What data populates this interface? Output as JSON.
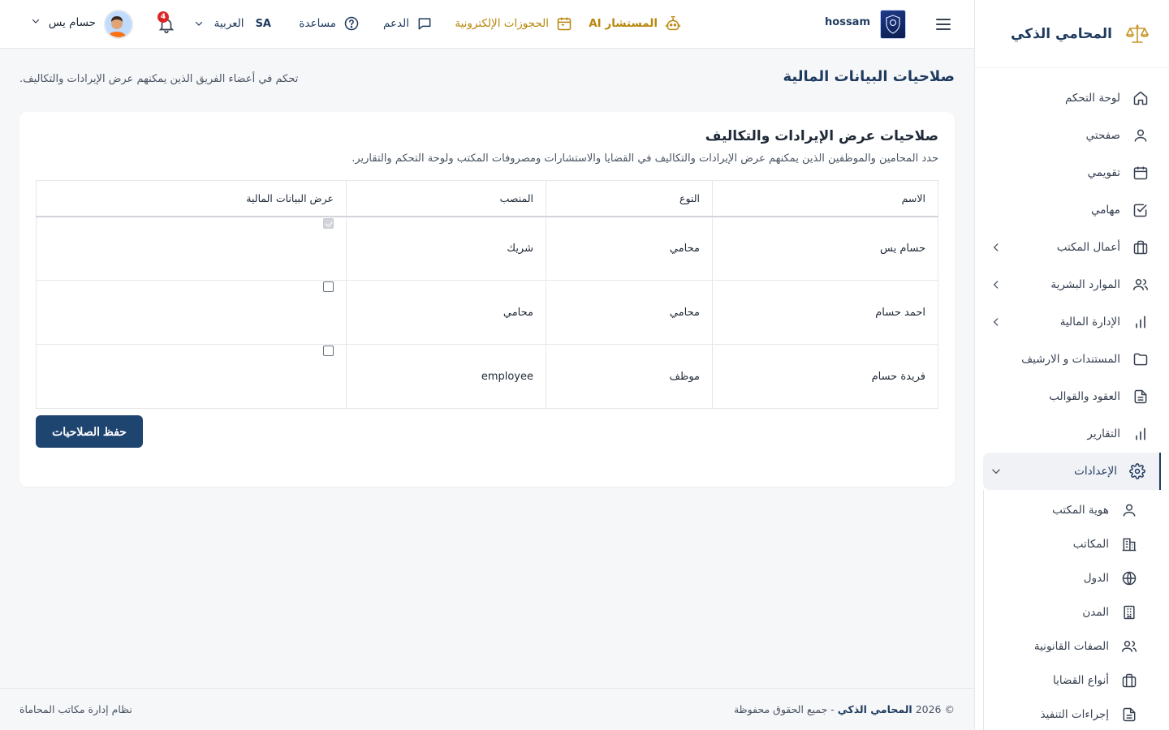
{
  "brand": {
    "name": "المحامي الذكي"
  },
  "sidebar": {
    "items": [
      {
        "label": "لوحة التحكم",
        "icon": "home-icon"
      },
      {
        "label": "صفحتي",
        "icon": "user-icon"
      },
      {
        "label": "تقويمي",
        "icon": "calendar-icon"
      },
      {
        "label": "مهامي",
        "icon": "checkbox-icon"
      },
      {
        "label": "أعمال المكتب",
        "icon": "briefcase-icon"
      },
      {
        "label": "الموارد البشرية",
        "icon": "users-icon"
      },
      {
        "label": "الإدارة المالية",
        "icon": "bar-chart-icon"
      },
      {
        "label": "المستندات و الارشيف",
        "icon": "folder-icon"
      },
      {
        "label": "العقود والقوالب",
        "icon": "document-icon"
      },
      {
        "label": "التقارير",
        "icon": "bar-chart-icon"
      },
      {
        "label": "الإعدادات",
        "icon": "gear-icon"
      }
    ],
    "subitems": [
      {
        "label": "هوية المكتب",
        "icon": "user-icon"
      },
      {
        "label": "المكاتب",
        "icon": "building-icon"
      },
      {
        "label": "الدول",
        "icon": "globe-icon"
      },
      {
        "label": "المدن",
        "icon": "city-icon"
      },
      {
        "label": "الصفات القانونية",
        "icon": "users-icon"
      },
      {
        "label": "أنواع القضايا",
        "icon": "briefcase-icon"
      },
      {
        "label": "إجراءات التنفيذ",
        "icon": "document-icon"
      }
    ]
  },
  "topbar": {
    "org_name": "hossam",
    "ai_label": "المستشار AI",
    "bookings_label": "الحجوزات الإلكترونية",
    "support_label": "الدعم",
    "help_label": "مساعدة",
    "language_label": "العربية",
    "language_code": "SA",
    "notifications_count": "4",
    "user_name": "حسام يس"
  },
  "page": {
    "title": "صلاحيات البيانات المالية",
    "subtitle": "تحكم في أعضاء الفريق الذين يمكنهم عرض الإيرادات والتكاليف."
  },
  "card": {
    "title": "صلاحيات عرض الإيرادات والتكاليف",
    "description": "حدد المحامين والموظفين الذين يمكنهم عرض الإيرادات والتكاليف في القضايا والاستشارات ومصروفات المكتب ولوحة التحكم والتقارير.",
    "save_label": "حفظ الصلاحيات"
  },
  "table": {
    "headers": {
      "name": "الاسم",
      "type": "النوع",
      "position": "المنصب",
      "financial": "عرض البيانات المالية"
    },
    "rows": [
      {
        "name": "حسام يس",
        "type": "محامي",
        "position": "شريك",
        "financial": true,
        "locked": true
      },
      {
        "name": "احمد حسام",
        "type": "محامي",
        "position": "محامي",
        "financial": false,
        "locked": false
      },
      {
        "name": "فريدة حسام",
        "type": "موظف",
        "position": "employee",
        "financial": false,
        "locked": false
      }
    ]
  },
  "footer": {
    "copyright_prefix": "© 2026",
    "copyright_brand": "المحامي الذكي",
    "copyright_suffix": "- جميع الحقوق محفوظة",
    "system_name": "نظام إدارة مكاتب المحاماة"
  },
  "colors": {
    "primary": "#1e3a5f",
    "button": "#1e4470",
    "accent_gold": "#b8860b",
    "badge": "#dc2626"
  }
}
